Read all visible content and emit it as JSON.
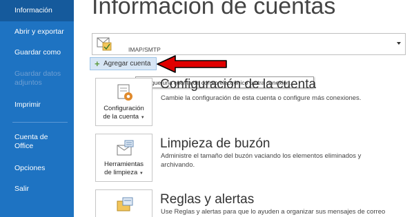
{
  "sidebar": {
    "items": [
      {
        "label": "Información"
      },
      {
        "label": "Abrir y exportar"
      },
      {
        "label": "Guardar como"
      },
      {
        "label": "Guardar datos adjuntos"
      },
      {
        "label": "Imprimir"
      },
      {
        "label": "Cuenta de Office"
      },
      {
        "label": "Opciones"
      },
      {
        "label": "Salir"
      }
    ]
  },
  "main": {
    "title": "Información de cuentas",
    "account_selector": {
      "value": "IMAP/SMTP"
    },
    "add_account_label": "Agregar cuenta",
    "tooltip": "Agregue una cuenta de correo electrónico u otra conexión.",
    "sections": [
      {
        "card_label_line1": "Configuración",
        "card_label_line2": "de la cuenta",
        "heading": "Configuración de la cuenta",
        "description": "Cambie la configuración de esta cuenta o configure más conexiones."
      },
      {
        "card_label_line1": "Herramientas",
        "card_label_line2": "de limpieza",
        "heading": "Limpieza de buzón",
        "description": "Administre el tamaño del buzón vaciando los elementos eliminados y archivando."
      },
      {
        "card_label_line1": "",
        "card_label_line2": "",
        "heading": "Reglas y alertas",
        "description": "Use Reglas y alertas para que lo ayuden a organizar sus mensajes de correo"
      }
    ]
  },
  "colors": {
    "sidebar_bg": "#1e73c2",
    "sidebar_active": "#155a9c",
    "annotation_arrow": "#e00000",
    "add_button_bg": "#d7e6f5"
  },
  "icons": [
    "account-envelope-icon",
    "plus-icon",
    "gear-icon",
    "cleanup-icon",
    "rules-icon",
    "chevron-down-icon"
  ]
}
